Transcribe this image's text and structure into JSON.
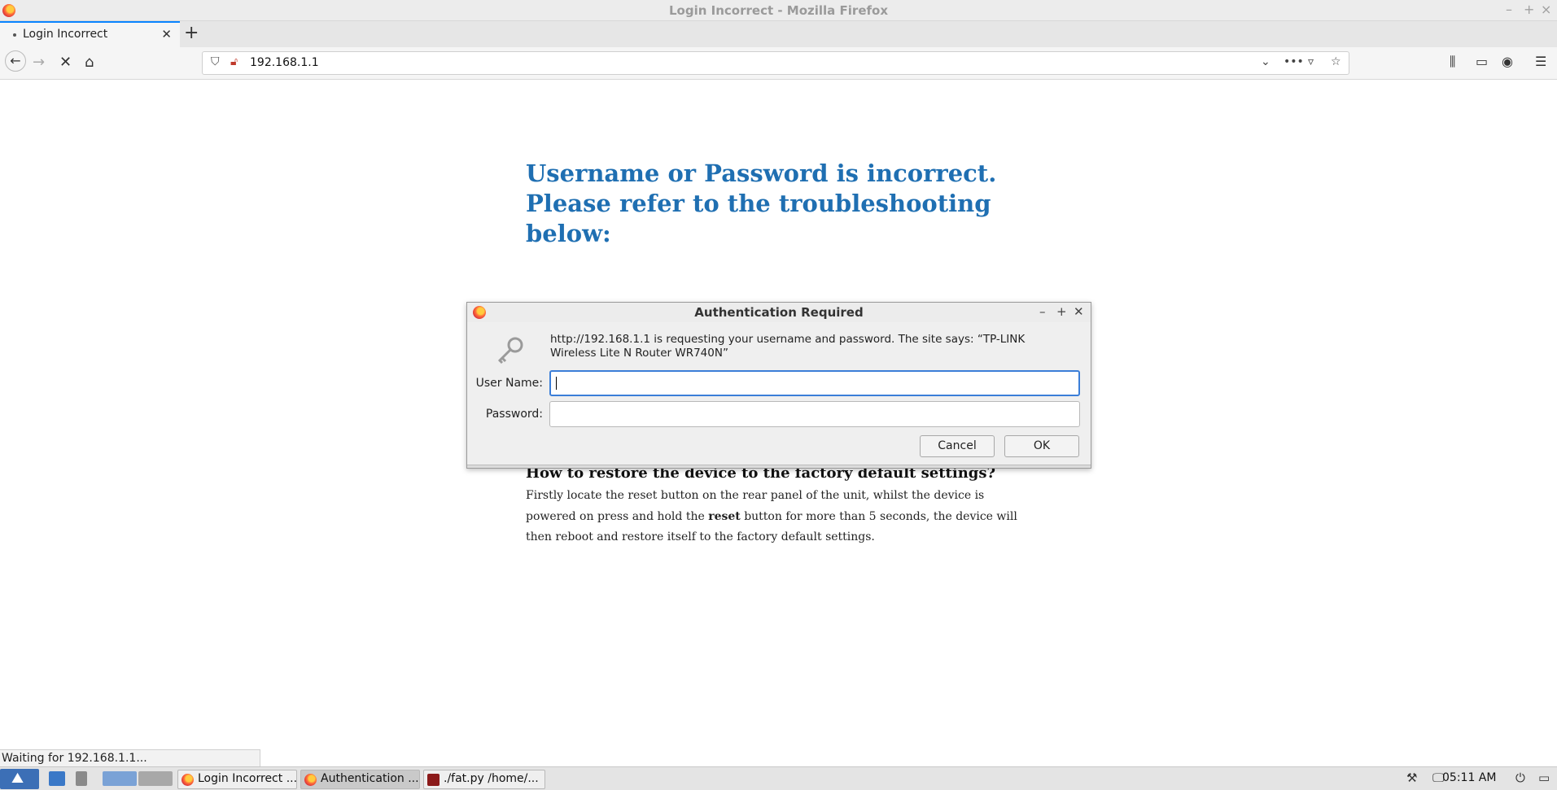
{
  "window": {
    "title": "Login Incorrect - Mozilla Firefox"
  },
  "tabs": [
    {
      "label": "Login Incorrect"
    }
  ],
  "urlbar": {
    "url": "192.168.1.1"
  },
  "page": {
    "error_heading_line1": "Username or Password is incorrect.",
    "error_heading_line2": "Please refer to the troubleshooting",
    "error_heading_line3": "below:",
    "restore_heading": "How to restore the device to the factory default settings?",
    "restore_text_1": "Firstly locate the reset button on the rear panel of the unit, whilst the device is powered on press and hold the ",
    "restore_text_bold": "reset",
    "restore_text_2": " button for more than 5 seconds, the device will then reboot and restore itself to the factory default settings."
  },
  "dialog": {
    "title": "Authentication Required",
    "message": "http://192.168.1.1 is requesting your username and password. The site says: “TP-LINK Wireless Lite N Router WR740N”",
    "username_label": "User Name:",
    "username_value": "",
    "password_label": "Password:",
    "password_value": "",
    "cancel_label": "Cancel",
    "ok_label": "OK"
  },
  "status": {
    "text": "Waiting for 192.168.1.1..."
  },
  "taskbar": {
    "tasks": [
      {
        "label": "Login Incorrect ..."
      },
      {
        "label": "Authentication ..."
      },
      {
        "label": "./fat.py /home/..."
      }
    ],
    "clock": "05:11 AM"
  },
  "colors": {
    "accent": "#0a84ff",
    "heading_blue": "#1f6fb2",
    "focus_blue": "#3b7ed8"
  }
}
